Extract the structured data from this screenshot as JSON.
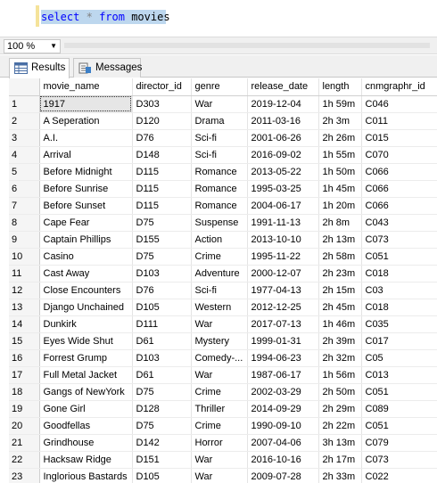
{
  "editor": {
    "select_kw": "select",
    "star": "*",
    "from_kw": "from",
    "table": "movies"
  },
  "zoom": {
    "value": "100 %"
  },
  "tabs": [
    {
      "label": "Results",
      "icon": "grid-icon",
      "active": true
    },
    {
      "label": "Messages",
      "icon": "messages-icon",
      "active": false
    }
  ],
  "grid": {
    "columns": [
      "movie_name",
      "director_id",
      "genre",
      "release_date",
      "length",
      "cnmgraphr_id"
    ],
    "rows": [
      [
        "1",
        "1917",
        "D303",
        "War",
        "2019-12-04",
        "1h 59m",
        "C046"
      ],
      [
        "2",
        "A Seperation",
        "D120",
        "Drama",
        "2011-03-16",
        "2h 3m",
        "C011"
      ],
      [
        "3",
        "A.I.",
        "D76",
        "Sci-fi",
        "2001-06-26",
        "2h 26m",
        "C015"
      ],
      [
        "4",
        "Arrival",
        "D148",
        "Sci-fi",
        "2016-09-02",
        "1h 55m",
        "C070"
      ],
      [
        "5",
        "Before Midnight",
        "D115",
        "Romance",
        "2013-05-22",
        "1h 50m",
        "C066"
      ],
      [
        "6",
        "Before Sunrise",
        "D115",
        "Romance",
        "1995-03-25",
        "1h 45m",
        "C066"
      ],
      [
        "7",
        "Before Sunset",
        "D115",
        "Romance",
        "2004-06-17",
        "1h 20m",
        "C066"
      ],
      [
        "8",
        "Cape Fear",
        "D75",
        "Suspense",
        "1991-11-13",
        "2h 8m",
        "C043"
      ],
      [
        "9",
        "Captain Phillips",
        "D155",
        "Action",
        "2013-10-10",
        "2h 13m",
        "C073"
      ],
      [
        "10",
        "Casino",
        "D75",
        "Crime",
        "1995-11-22",
        "2h 58m",
        "C051"
      ],
      [
        "11",
        "Cast Away",
        "D103",
        "Adventure",
        "2000-12-07",
        "2h 23m",
        "C018"
      ],
      [
        "12",
        "Close Encounters",
        "D76",
        "Sci-fi",
        "1977-04-13",
        "2h 15m",
        "C03"
      ],
      [
        "13",
        "Django Unchained",
        "D105",
        "Western",
        "2012-12-25",
        "2h 45m",
        "C018"
      ],
      [
        "14",
        "Dunkirk",
        "D111",
        "War",
        "2017-07-13",
        "1h 46m",
        "C035"
      ],
      [
        "15",
        "Eyes Wide Shut",
        "D61",
        "Mystery",
        "1999-01-31",
        "2h 39m",
        "C017"
      ],
      [
        "16",
        "Forrest Grump",
        "D103",
        "Comedy-...",
        "1994-06-23",
        "2h 32m",
        "C05"
      ],
      [
        "17",
        "Full Metal Jacket",
        "D61",
        "War",
        "1987-06-17",
        "1h 56m",
        "C013"
      ],
      [
        "18",
        "Gangs of NewYork",
        "D75",
        "Crime",
        "2002-03-29",
        "2h 50m",
        "C051"
      ],
      [
        "19",
        "Gone Girl",
        "D128",
        "Thriller",
        "2014-09-29",
        "2h 29m",
        "C089"
      ],
      [
        "20",
        "Goodfellas",
        "D75",
        "Crime",
        "1990-09-10",
        "2h 22m",
        "C051"
      ],
      [
        "21",
        "Grindhouse",
        "D142",
        "Horror",
        "2007-04-06",
        "3h 13m",
        "C079"
      ],
      [
        "22",
        "Hacksaw Ridge",
        "D151",
        "War",
        "2016-10-16",
        "2h 17m",
        "C073"
      ],
      [
        "23",
        "Inglorious Bastards",
        "D105",
        "War",
        "2009-07-28",
        "2h 33m",
        "C022"
      ]
    ]
  }
}
